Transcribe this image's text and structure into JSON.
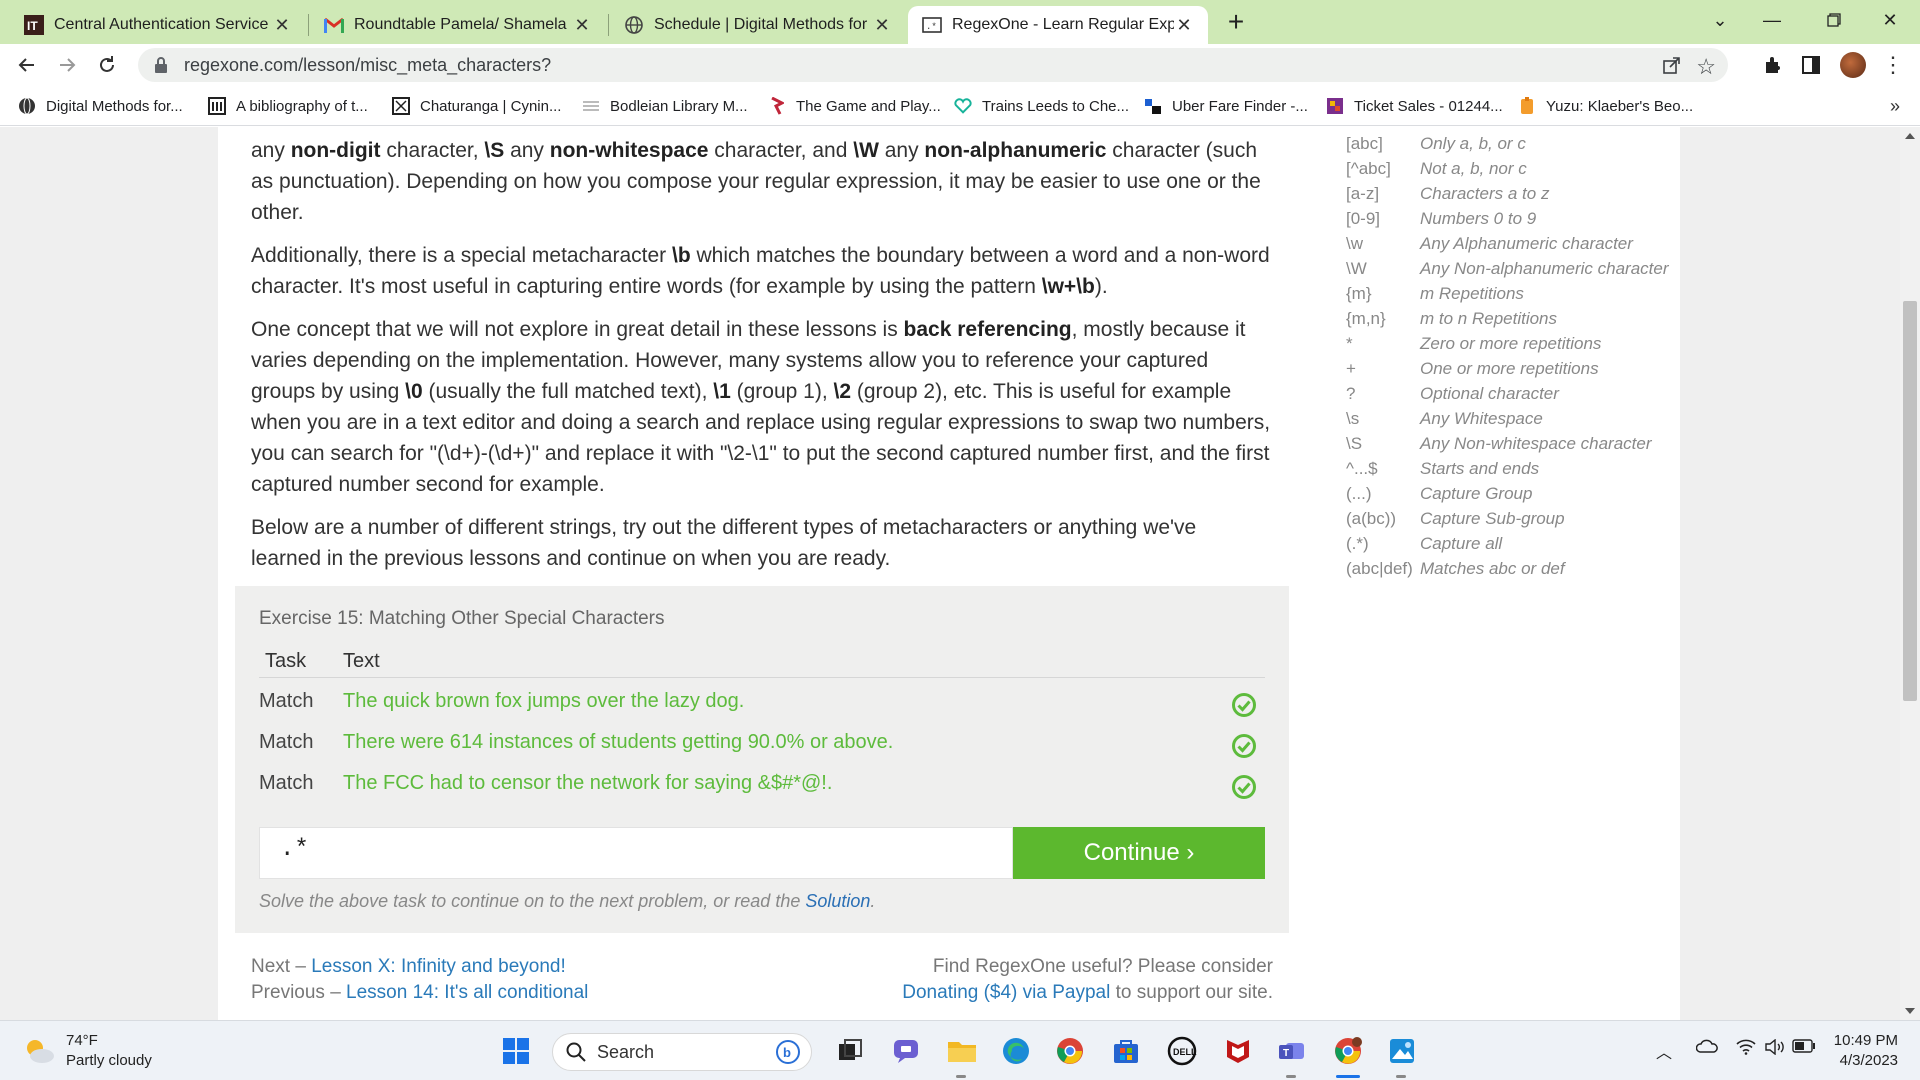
{
  "browser": {
    "tabs": [
      {
        "title": "Central Authentication Service",
        "icon": "it-logo-icon",
        "active": false
      },
      {
        "title": "Roundtable Pamela/ Shamela ne",
        "icon": "gmail-icon",
        "active": false
      },
      {
        "title": "Schedule | Digital Methods for Hi",
        "icon": "globe-icon",
        "active": false
      },
      {
        "title": "RegexOne - Learn Regular Expres",
        "icon": "regexone-icon",
        "active": true
      }
    ],
    "url": "regexone.com/lesson/misc_meta_characters?",
    "bookmarks": [
      {
        "label": "Digital Methods for...",
        "icon": "globe-icon"
      },
      {
        "label": "A bibliography of t...",
        "icon": "library-icon"
      },
      {
        "label": "Chaturanga | Cynin...",
        "icon": "chess-icon"
      },
      {
        "label": "Bodleian Library M...",
        "icon": "bodleian-icon"
      },
      {
        "label": "The Game and Play...",
        "icon": "game-icon"
      },
      {
        "label": "Trains Leeds to Che...",
        "icon": "trainline-icon"
      },
      {
        "label": "Uber Fare Finder -...",
        "icon": "uber-icon"
      },
      {
        "label": "Ticket Sales - 01244...",
        "icon": "ticket-icon"
      },
      {
        "label": "Yuzu: Klaeber's Beo...",
        "icon": "yuzu-icon"
      }
    ],
    "bookmarks_more": "»"
  },
  "lesson": {
    "p1": {
      "t1": "any ",
      "b1": "non-digit",
      "t2": " character, ",
      "b2": "\\S",
      "t3": " any ",
      "b3": "non-whitespace",
      "t4": " character, and ",
      "b4": "\\W",
      "t5": " any ",
      "b5": "non-alphanumeric",
      "t6": " character (such as punctuation). Depending on how you compose your regular expression, it may be easier to use one or the other."
    },
    "p2": {
      "t1": "Additionally, there is a special metacharacter ",
      "b1": "\\b",
      "t2": " which matches the boundary between a word and a non-word character. It's most useful in capturing entire words (for example by using the pattern ",
      "b2": "\\w+\\b",
      "t3": ")."
    },
    "p3": {
      "t1": "One concept that we will not explore in great detail in these lessons is ",
      "b1": "back referencing",
      "t2": ", mostly because it varies depending on the implementation. However, many systems allow you to reference your captured groups by using ",
      "b2": "\\0",
      "t3": " (usually the full matched text), ",
      "b3": "\\1",
      "t4": " (group 1), ",
      "b4": "\\2",
      "t5": " (group 2), etc. This is useful for example when you are in a text editor and doing a search and replace using regular expressions to swap two numbers, you can search for \"(\\d+)-(\\d+)\" and replace it with \"\\2-\\1\" to put the second captured number first, and the first captured number second for example."
    },
    "p4": "Below are a number of different strings, try out the different types of metacharacters or anything we've learned in the previous lessons and continue on when you are ready."
  },
  "exercise": {
    "title": "Exercise 15: Matching Other Special Characters",
    "col_task": "Task",
    "col_text": "Text",
    "rows": [
      {
        "task": "Match",
        "text": "The quick brown fox jumps over the lazy dog.",
        "status": "check-circle-icon"
      },
      {
        "task": "Match",
        "text": "There were 614 instances of students getting 90.0% or above.",
        "status": "check-circle-icon"
      },
      {
        "task": "Match",
        "text": "The FCC had to censor the network for saying &$#*@!.",
        "status": "check-circle-icon"
      }
    ],
    "input_value": ".*",
    "continue_label": "Continue ›",
    "hint_prefix": "Solve the above task to continue on to the next problem, or read the ",
    "hint_link": "Solution",
    "hint_suffix": "."
  },
  "footer": {
    "next_prefix": "Next – ",
    "next_link": "Lesson X: Infinity and beyond!",
    "prev_prefix": "Previous – ",
    "prev_link": "Lesson 14: It's all conditional",
    "donate_line1": "Find RegexOne useful? Please consider",
    "donate_link": "Donating ($4) via Paypal",
    "donate_suffix": " to support our site."
  },
  "cheatsheet": [
    {
      "sym": "[abc]",
      "desc": "Only a, b, or c"
    },
    {
      "sym": "[^abc]",
      "desc": "Not a, b, nor c"
    },
    {
      "sym": "[a-z]",
      "desc": "Characters a to z"
    },
    {
      "sym": "[0-9]",
      "desc": "Numbers 0 to 9"
    },
    {
      "sym": "\\w",
      "desc": "Any Alphanumeric character"
    },
    {
      "sym": "\\W",
      "desc": "Any Non-alphanumeric character"
    },
    {
      "sym": "{m}",
      "desc": "m Repetitions"
    },
    {
      "sym": "{m,n}",
      "desc": "m to n Repetitions"
    },
    {
      "sym": "*",
      "desc": "Zero or more repetitions"
    },
    {
      "sym": "+",
      "desc": "One or more repetitions"
    },
    {
      "sym": "?",
      "desc": "Optional character"
    },
    {
      "sym": "\\s",
      "desc": "Any Whitespace"
    },
    {
      "sym": "\\S",
      "desc": "Any Non-whitespace character"
    },
    {
      "sym": "^...$",
      "desc": "Starts and ends"
    },
    {
      "sym": "(...)",
      "desc": "Capture Group"
    },
    {
      "sym": "(a(bc))",
      "desc": "Capture Sub-group"
    },
    {
      "sym": "(.*)",
      "desc": "Capture all"
    },
    {
      "sym": "(abc|def)",
      "desc": "Matches abc or def"
    }
  ],
  "taskbar": {
    "weather_temp": "74°F",
    "weather_desc": "Partly cloudy",
    "search_label": "Search",
    "time": "10:49 PM",
    "date": "4/3/2023"
  },
  "colors": {
    "tabstrip": "#cfe9b6",
    "match_green": "#5dbb3c",
    "continue_green": "#5cb82e",
    "link_blue": "#2a7ab9"
  }
}
